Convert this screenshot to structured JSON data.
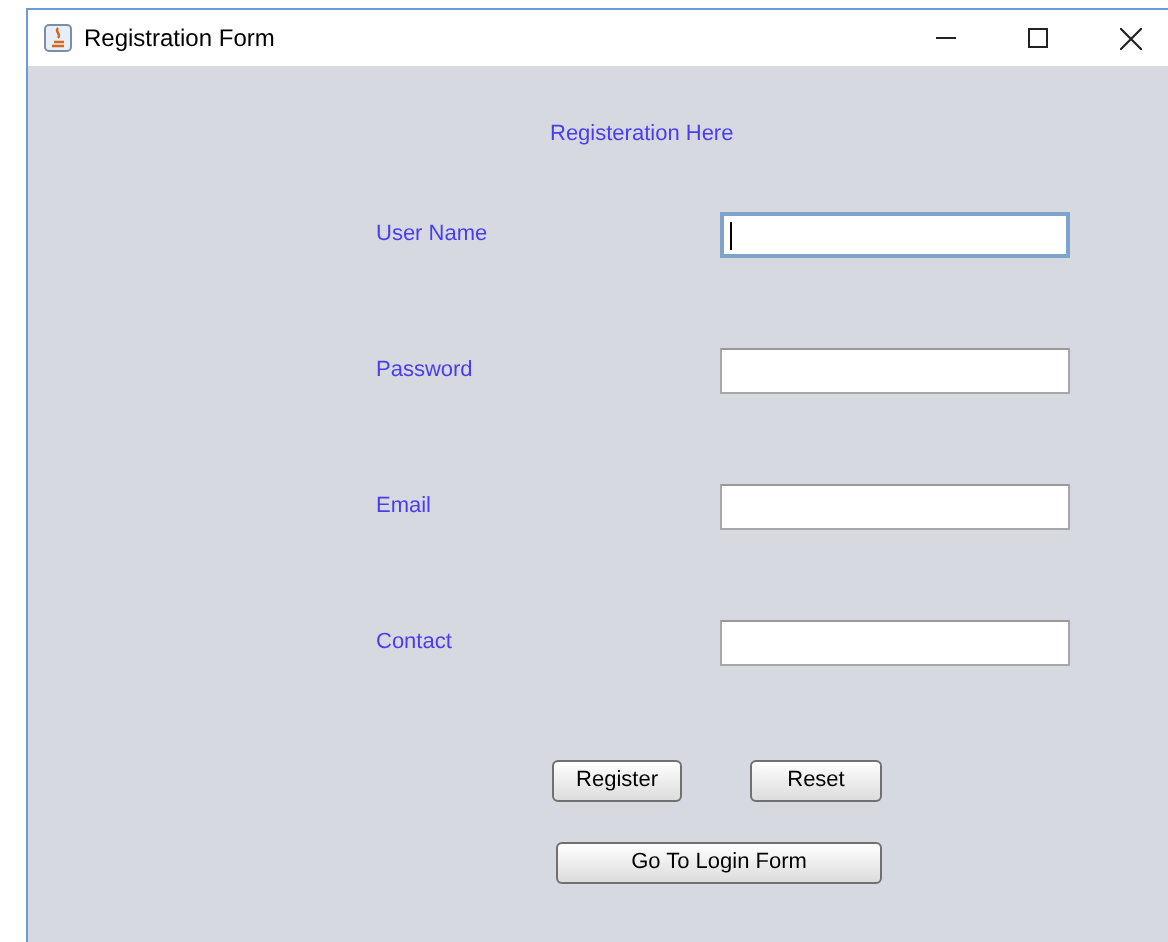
{
  "window": {
    "title": "Registration Form"
  },
  "heading": "Registeration Here",
  "fields": [
    {
      "label": "User Name",
      "focused": true
    },
    {
      "label": "Password",
      "focused": false
    },
    {
      "label": "Email",
      "focused": false
    },
    {
      "label": "Contact",
      "focused": false
    }
  ],
  "buttons": [
    "Register",
    "Reset"
  ],
  "login_button": "Go To Login Form"
}
